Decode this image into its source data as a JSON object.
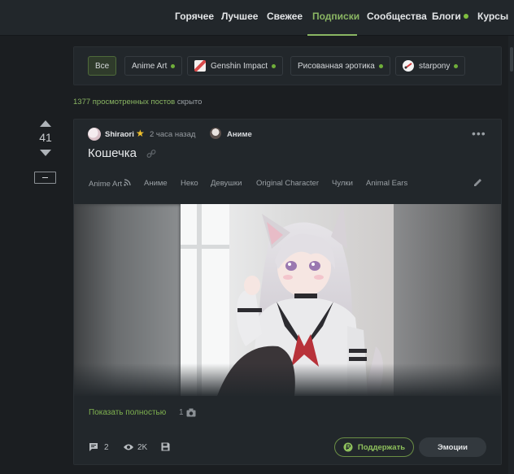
{
  "nav": {
    "items": [
      {
        "label": "Горячее",
        "active": false
      },
      {
        "label": "Лучшее",
        "active": false
      },
      {
        "label": "Свежее",
        "active": false
      },
      {
        "label": "Подписки",
        "active": true
      },
      {
        "label": "Сообщества",
        "active": false
      },
      {
        "label": "Блоги",
        "active": false,
        "dot": true
      },
      {
        "label": "Курсы",
        "active": false
      }
    ]
  },
  "subscriptions": {
    "chips": [
      {
        "label": "Все",
        "active": true
      },
      {
        "label": "Anime Art",
        "dot": true
      },
      {
        "label": "Genshin Impact",
        "dot": true,
        "icon": "genshin-impact-icon"
      },
      {
        "label": "Рисованная эротика",
        "dot": true
      },
      {
        "label": "starpony",
        "dot": true,
        "icon": "starpony-icon"
      }
    ],
    "hidden_count_link": "1377 просмотренных постов",
    "hidden_suffix": "скрыто"
  },
  "post": {
    "rating": "41",
    "author": "Shiraori",
    "time": "2 часа назад",
    "community": "Аниме",
    "title": "Кошечка",
    "tags": [
      "Anime Art",
      "Аниме",
      "Неко",
      "Девушки",
      "Original Character",
      "Чулки",
      "Animal Ears"
    ],
    "image_description_icon": "anime-catgirl-image",
    "show_full": "Показать полностью",
    "image_count": "1",
    "comments_count": "2",
    "views": "2K",
    "support_label": "Поддержать",
    "emotions_label": "Эмоции"
  },
  "colors": {
    "accent": "#8ab663",
    "background": "#1b1e21",
    "card": "#22272b"
  }
}
